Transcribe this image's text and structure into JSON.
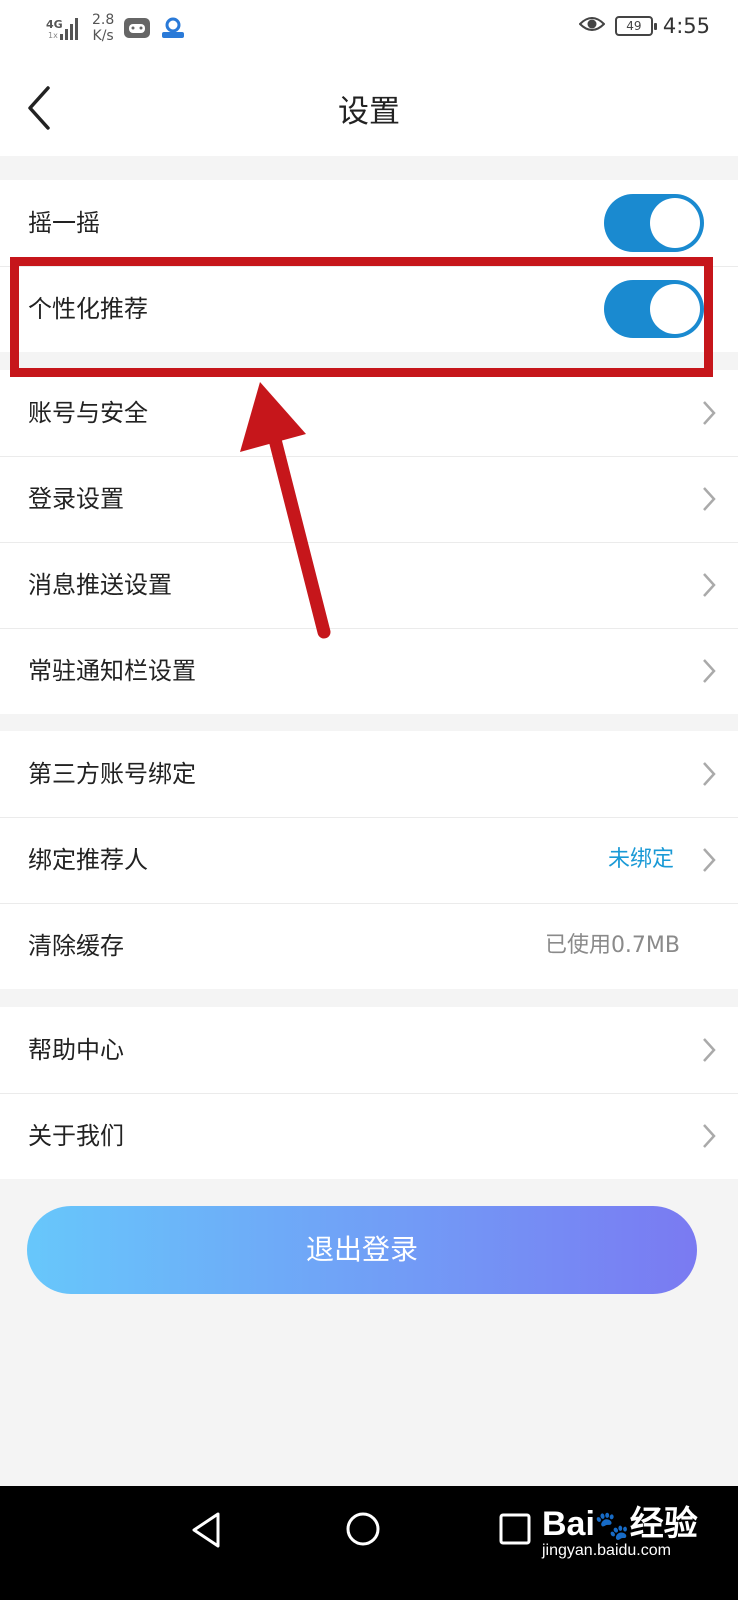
{
  "status_bar": {
    "network": "4G",
    "network_sub": "1x",
    "speed_value": "2.8",
    "speed_unit": "K/s",
    "battery": "49",
    "time": "4:55",
    "icons": [
      "signal-icon",
      "game-app-icon",
      "baidu-app-icon",
      "eye-icon",
      "battery-icon"
    ]
  },
  "header": {
    "title": "设置",
    "back_icon": "chevron-left-icon"
  },
  "group1": {
    "items": [
      {
        "label": "摇一摇",
        "toggle_on": true
      },
      {
        "label": "个性化推荐",
        "toggle_on": true
      },
      {
        "label": "账号与安全"
      },
      {
        "label": "登录设置"
      },
      {
        "label": "消息推送设置"
      },
      {
        "label": "常驻通知栏设置"
      }
    ]
  },
  "group2": {
    "items": [
      {
        "label": "第三方账号绑定"
      },
      {
        "label": "绑定推荐人",
        "value": "未绑定"
      },
      {
        "label": "清除缓存",
        "value": "已使用0.7MB"
      }
    ]
  },
  "group3": {
    "items": [
      {
        "label": "帮助中心"
      },
      {
        "label": "关于我们"
      }
    ]
  },
  "logout_label": "退出登录",
  "watermark": {
    "brand": "Bai",
    "brand2": "经验",
    "url": "jingyan.baidu.com"
  },
  "colors": {
    "toggle_on": "#1a8ad0",
    "link_value": "#1a9ad6",
    "muted_value": "#8a8a8a",
    "annotation": "#c6161b",
    "logout_gradient_start": "#67c7fb",
    "logout_gradient_end": "#7a7af2"
  }
}
